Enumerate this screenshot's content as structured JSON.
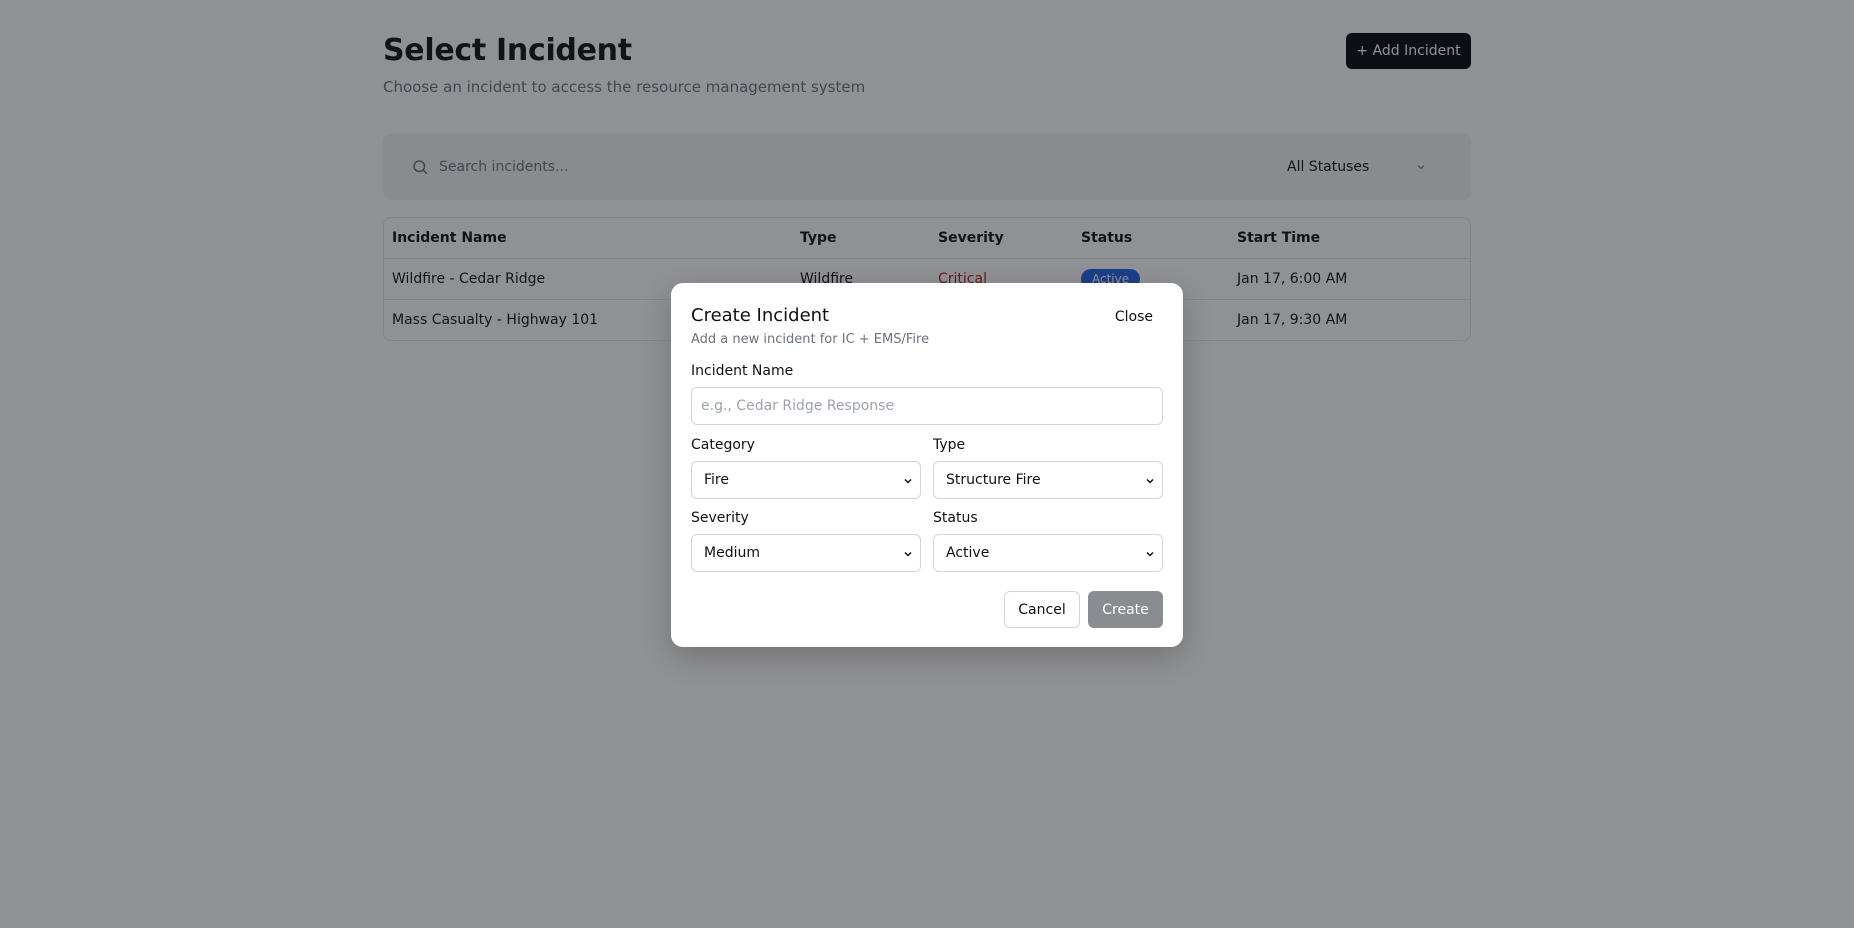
{
  "header": {
    "title": "Select Incident",
    "subtitle": "Choose an incident to access the resource management system",
    "add_label": "+ Add Incident"
  },
  "filters": {
    "search_placeholder": "Search incidents...",
    "status_value": "All Statuses",
    "search_icon": "search-icon",
    "chevron_icon": "chevron-down-icon"
  },
  "table": {
    "columns": [
      "Incident Name",
      "Type",
      "Severity",
      "Status",
      "Start Time"
    ],
    "rows": [
      {
        "name": "Wildfire - Cedar Ridge",
        "type": "Wildfire",
        "severity": "Critical",
        "status": "Active",
        "start": "Jan 17, 6:00 AM"
      },
      {
        "name": "Mass Casualty - Highway 101",
        "type": "",
        "severity": "",
        "status": "",
        "start": "Jan 17, 9:30 AM"
      }
    ]
  },
  "modal": {
    "title": "Create Incident",
    "subtitle": "Add a new incident for IC + EMS/Fire",
    "close_label": "Close",
    "name_label": "Incident Name",
    "name_placeholder": "e.g., Cedar Ridge Response",
    "category_label": "Category",
    "category_value": "Fire",
    "type_label": "Type",
    "type_value": "Structure Fire",
    "severity_label": "Severity",
    "severity_value": "Medium",
    "status_label": "Status",
    "status_value": "Active",
    "cancel_label": "Cancel",
    "create_label": "Create"
  },
  "colors": {
    "primary_button": "#0a0a12",
    "critical": "#b91c1c",
    "active_badge": "#2563eb",
    "create_disabled": "#8b8b92"
  }
}
